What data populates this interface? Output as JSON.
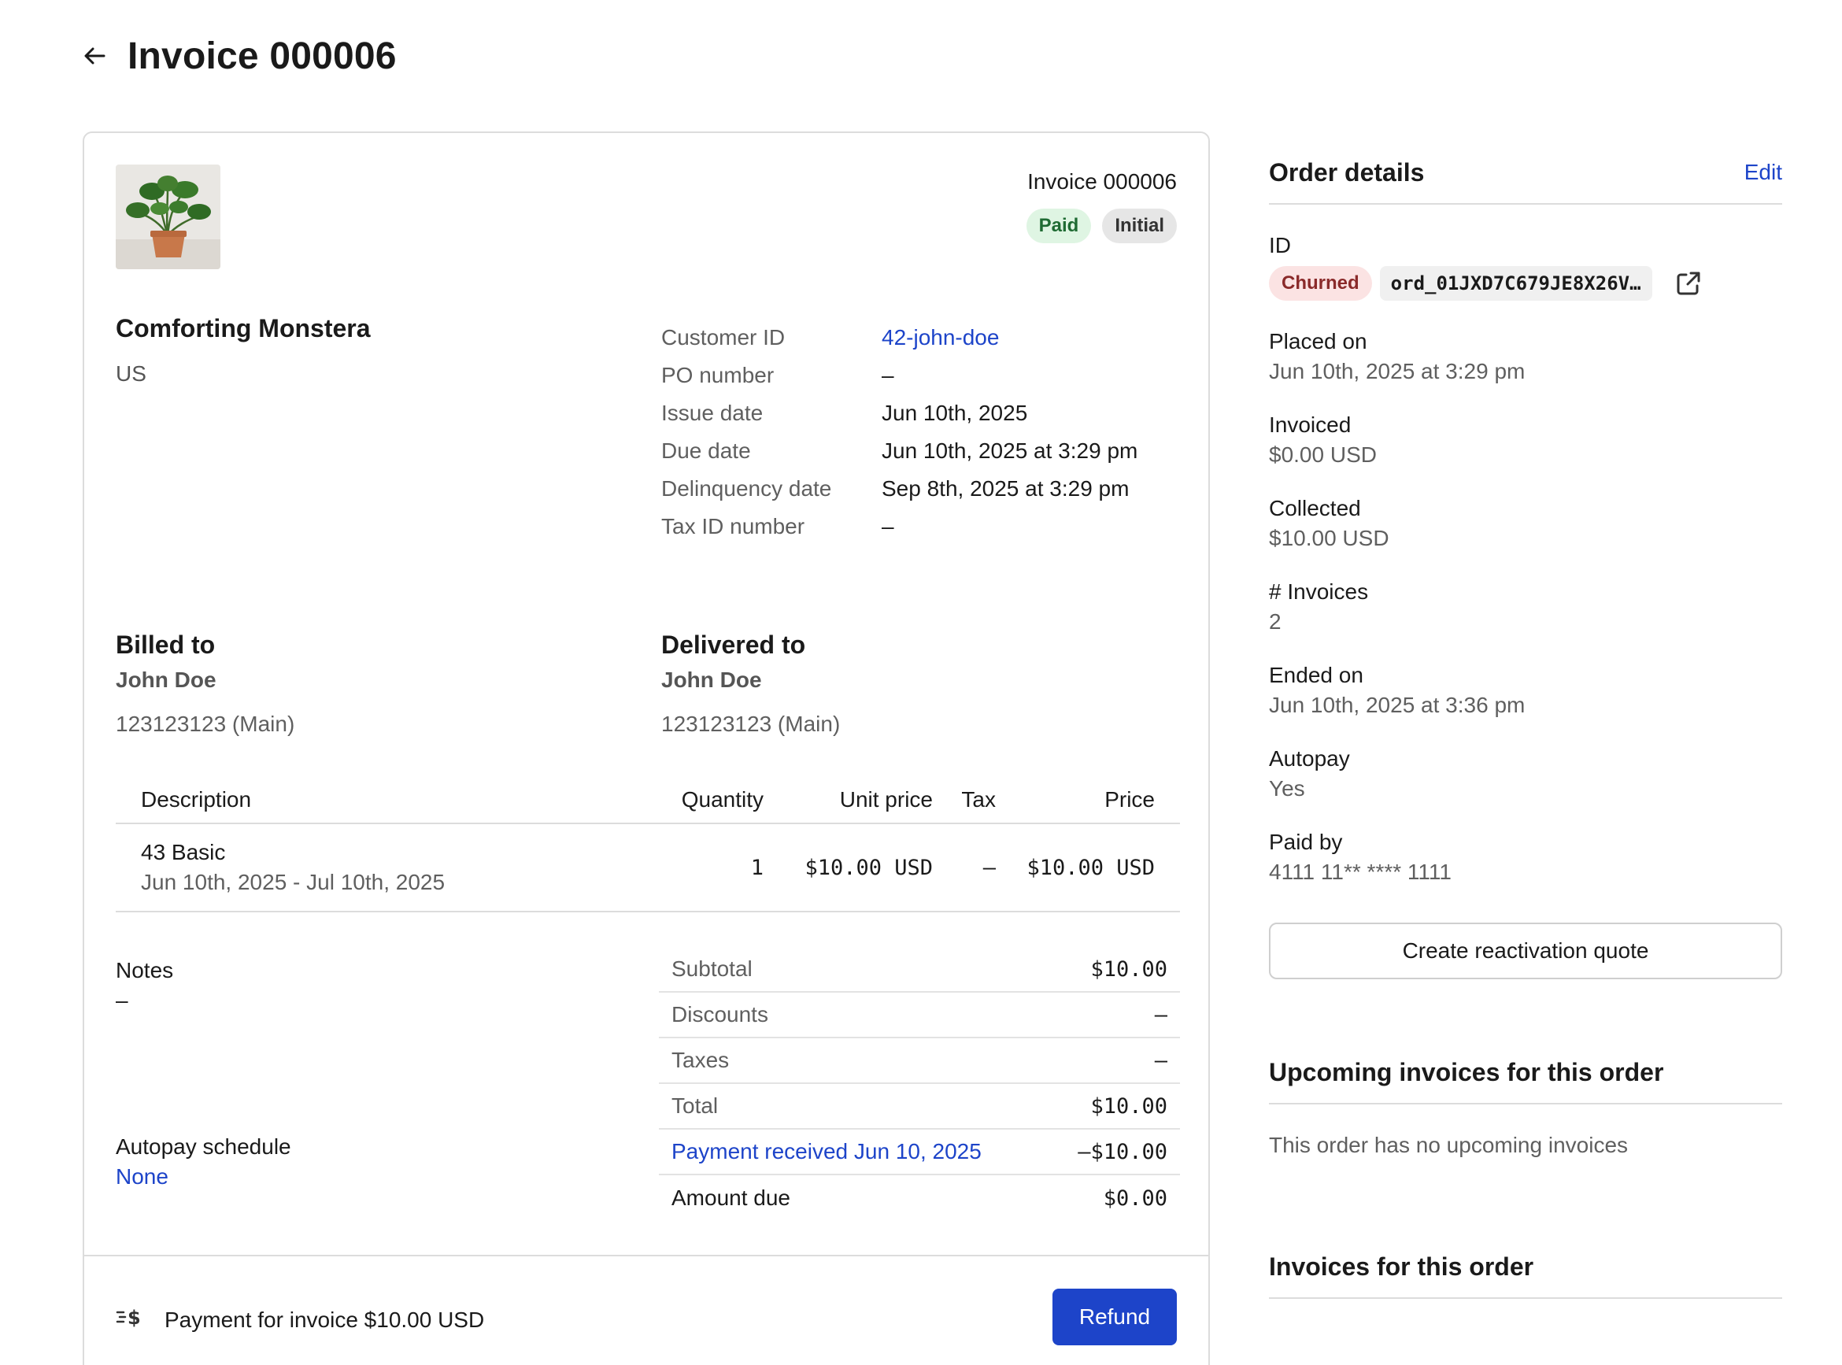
{
  "header": {
    "title": "Invoice 000006"
  },
  "invoice": {
    "number_label": "Invoice 000006",
    "badges": {
      "paid": "Paid",
      "initial": "Initial"
    },
    "company": "Comforting Monstera",
    "country": "US",
    "meta": [
      {
        "label": "Customer ID",
        "value": "42-john-doe"
      },
      {
        "label": "PO number",
        "value": "–"
      },
      {
        "label": "Issue date",
        "value": "Jun 10th, 2025"
      },
      {
        "label": "Due date",
        "value": "Jun 10th, 2025 at 3:29 pm"
      },
      {
        "label": "Delinquency date",
        "value": "Sep 8th, 2025 at 3:29 pm"
      },
      {
        "label": "Tax ID number",
        "value": "–"
      }
    ],
    "billed_to": {
      "heading": "Billed to",
      "name": "John Doe",
      "phone": "123123123 (Main)"
    },
    "delivered_to": {
      "heading": "Delivered to",
      "name": "John Doe",
      "phone": "123123123 (Main)"
    },
    "items_header": {
      "description": "Description",
      "quantity": "Quantity",
      "unit_price": "Unit price",
      "tax": "Tax",
      "price": "Price"
    },
    "items": [
      {
        "name": "43 Basic",
        "period": "Jun 10th, 2025 - Jul 10th, 2025",
        "quantity": "1",
        "unit_price": "$10.00 USD",
        "tax": "–",
        "price": "$10.00 USD"
      }
    ],
    "notes": {
      "label": "Notes",
      "value": "–"
    },
    "autopay_schedule": {
      "label": "Autopay schedule",
      "value": "None"
    },
    "totals": [
      {
        "label": "Subtotal",
        "value": "$10.00"
      },
      {
        "label": "Discounts",
        "value": "–"
      },
      {
        "label": "Taxes",
        "value": "–"
      },
      {
        "label": "Total",
        "value": "$10.00"
      },
      {
        "label": "Payment received Jun 10, 2025",
        "value": "–$10.00"
      },
      {
        "label": "Amount due",
        "value": "$0.00"
      }
    ],
    "payment_line": "Payment for invoice $10.00 USD",
    "refund_label": "Refund"
  },
  "order": {
    "heading": "Order details",
    "edit_label": "Edit",
    "id_label": "ID",
    "status": "Churned",
    "id_value": "ord_01JXD7C679JE8X26V…",
    "placed_on": {
      "label": "Placed on",
      "value": "Jun 10th, 2025 at 3:29 pm"
    },
    "invoiced": {
      "label": "Invoiced",
      "value": "$0.00 USD"
    },
    "collected": {
      "label": "Collected",
      "value": "$10.00 USD"
    },
    "invoices_count": {
      "label": "# Invoices",
      "value": "2"
    },
    "ended_on": {
      "label": "Ended on",
      "value": "Jun 10th, 2025 at 3:36 pm"
    },
    "autopay": {
      "label": "Autopay",
      "value": "Yes"
    },
    "paid_by": {
      "label": "Paid by",
      "value": "4111 11** **** 1111"
    },
    "reactivate_label": "Create reactivation quote",
    "upcoming": {
      "heading": "Upcoming invoices for this order",
      "empty": "This order has no upcoming invoices"
    },
    "invoices_heading": "Invoices for this order"
  },
  "colors": {
    "accent": "#1d44c9",
    "paid_bg": "#dff5e3",
    "churned_bg": "#fbe3e3"
  }
}
